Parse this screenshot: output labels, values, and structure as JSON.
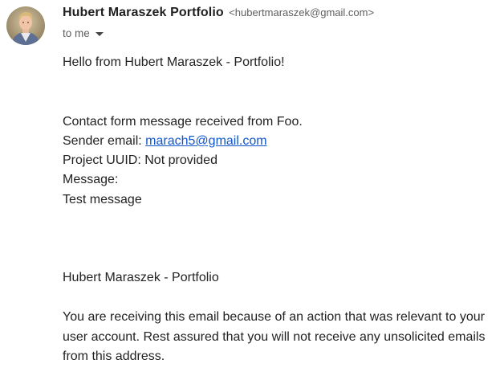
{
  "header": {
    "sender_name": "Hubert Maraszek Portfolio",
    "sender_email": "<hubertmaraszek@gmail.com>",
    "recipient_label": "to me",
    "recipient_icon": "chevron-down-icon",
    "avatar": "avatar"
  },
  "message": {
    "greeting": "Hello from Hubert Maraszek - Portfolio!",
    "intro": "Contact form message received from Foo.",
    "sender_email_label": "Sender email: ",
    "sender_email_value": "marach5@gmail.com",
    "project_uuid": "Project UUID: Not provided",
    "message_label": "Message:",
    "message_body": "Test message",
    "signature": "Hubert Maraszek - Portfolio",
    "footer": "You are receiving this email because of an action that was relevant to your user account. Rest assured that you will not receive any unsolicited emails from this address."
  },
  "colors": {
    "link": "#1155cc",
    "text": "#222222",
    "muted": "#5e5e5e"
  }
}
